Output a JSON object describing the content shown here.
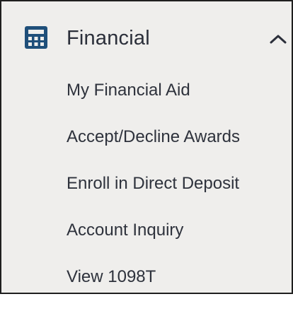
{
  "section": {
    "label": "Financial",
    "expanded": true,
    "icon": "calculator-icon",
    "toggle_icon": "chevron-up-icon",
    "accent_color": "#1f4f7a"
  },
  "menu": {
    "items": [
      {
        "label": "My Financial Aid"
      },
      {
        "label": "Accept/Decline Awards"
      },
      {
        "label": "Enroll in Direct Deposit"
      },
      {
        "label": "Account Inquiry"
      },
      {
        "label": "View 1098T"
      }
    ]
  }
}
